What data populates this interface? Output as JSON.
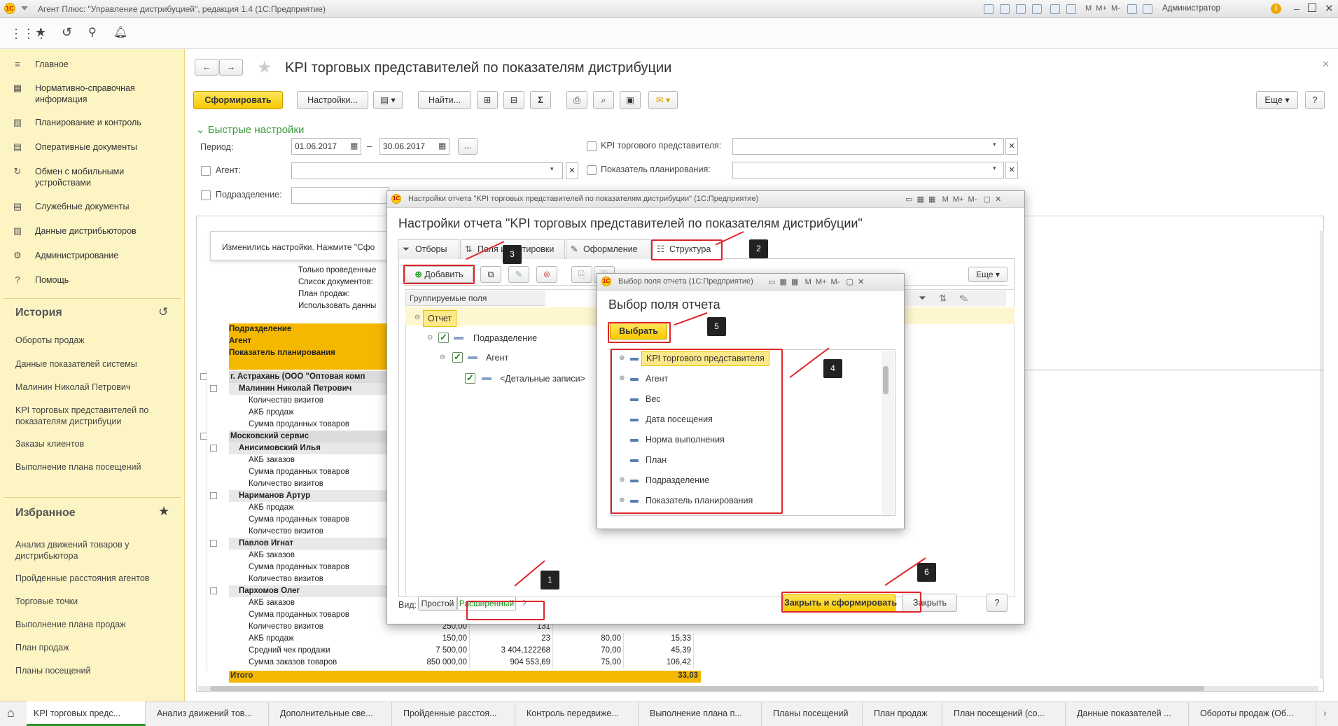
{
  "titlebar": {
    "title": "Агент Плюс: \"Управление дистрибуцией\", редакция 1.4  (1С:Предприятие)",
    "user": "Администратор"
  },
  "sidebar": {
    "items": [
      {
        "label": "Главное",
        "icon": "≡"
      },
      {
        "label": "Нормативно-справочная информация",
        "icon": "▦"
      },
      {
        "label": "Планирование и контроль",
        "icon": "▥"
      },
      {
        "label": "Оперативные документы",
        "icon": "▤"
      },
      {
        "label": "Обмен с мобильными устройствами",
        "icon": "↻"
      },
      {
        "label": "Служебные документы",
        "icon": "▤"
      },
      {
        "label": "Данные дистрибьюторов",
        "icon": "▥"
      },
      {
        "label": "Администрирование",
        "icon": "⚙"
      },
      {
        "label": "Помощь",
        "icon": "?"
      }
    ],
    "history_title": "История",
    "history": [
      "Обороты продаж",
      "Данные показателей системы",
      "Малинин Николай Петрович",
      "KPI торговых представителей по показателям дистрибуции",
      "Заказы клиентов",
      "Выполнение плана посещений"
    ],
    "favorites_title": "Избранное",
    "favorites": [
      "Анализ движений товаров у дистрибьютора",
      "Пройденные расстояния агентов",
      "Торговые точки",
      "Выполнение плана продаж",
      "План продаж",
      "Планы посещений"
    ]
  },
  "main": {
    "title": "KPI торговых представителей по показателям дистрибуции",
    "form_button": "Сформировать",
    "settings_button": "Настройки...",
    "find_button": "Найти...",
    "more_button": "Еще",
    "help_button": "?",
    "quick_settings": "Быстрые настройки",
    "period_label": "Период:",
    "date_from": "01.06.2017",
    "date_to": "30.06.2017",
    "dash": "–",
    "ellipsis": "...",
    "agent_label": "Агент:",
    "division_label": "Подразделение:",
    "kpi_label": "KPI торгового представителя:",
    "indicator_label": "Показатель планирования:"
  },
  "report": {
    "notice": "Изменились настройки. Нажмите \"Сфо",
    "filters": [
      "Только проведенные",
      "Список документов:",
      "План продаж:",
      "Использовать данны"
    ],
    "headers": [
      "Подразделение",
      "Агент",
      "Показатель планирования"
    ],
    "rows": [
      {
        "text": "г. Астрахань (ООО \"Оптовая комп",
        "bold": true,
        "bg": "#dcdcdc",
        "indent": 0
      },
      {
        "text": "Малинин Николай Петрович",
        "bold": true,
        "bg": "#e8e8e8",
        "indent": 1
      },
      {
        "text": "Количество визитов",
        "indent": 2
      },
      {
        "text": "АКБ продаж",
        "indent": 2
      },
      {
        "text": "Сумма проданных товаров",
        "indent": 2
      },
      {
        "text": "Московский сервис",
        "bold": true,
        "bg": "#dcdcdc",
        "indent": 0
      },
      {
        "text": "Анисимовский Илья",
        "bold": true,
        "bg": "#e8e8e8",
        "indent": 1
      },
      {
        "text": "АКБ заказов",
        "indent": 2
      },
      {
        "text": "Сумма проданных товаров",
        "indent": 2
      },
      {
        "text": "Количество визитов",
        "indent": 2
      },
      {
        "text": "Нариманов Артур",
        "bold": true,
        "bg": "#e8e8e8",
        "indent": 1
      },
      {
        "text": "АКБ продаж",
        "indent": 2
      },
      {
        "text": "Сумма проданных товаров",
        "indent": 2
      },
      {
        "text": "Количество визитов",
        "indent": 2
      },
      {
        "text": "Павлов Игнат",
        "bold": true,
        "bg": "#e8e8e8",
        "indent": 1
      },
      {
        "text": "АКБ заказов",
        "indent": 2
      },
      {
        "text": "Сумма проданных товаров",
        "indent": 2
      },
      {
        "text": "Количество визитов",
        "indent": 2
      },
      {
        "text": "Пархомов Олег",
        "bold": true,
        "bg": "#e8e8e8",
        "indent": 1
      },
      {
        "text": "АКБ заказов",
        "indent": 2
      },
      {
        "text": "Сумма проданных товаров",
        "indent": 2
      },
      {
        "text": "Количество визитов",
        "indent": 2,
        "vals": [
          "250,00",
          "131",
          "",
          ""
        ]
      },
      {
        "text": "АКБ продаж",
        "indent": 2,
        "vals": [
          "150,00",
          "23",
          "80,00",
          "15,33"
        ]
      },
      {
        "text": "Средний чек продажи",
        "indent": 2,
        "vals": [
          "7 500,00",
          "3 404,122268",
          "70,00",
          "45,39"
        ]
      },
      {
        "text": "Сумма заказов товаров",
        "indent": 2,
        "vals": [
          "850 000,00",
          "904 553,69",
          "75,00",
          "106,42"
        ]
      }
    ],
    "total_label": "Итого",
    "total_value": "33,03"
  },
  "settings_dialog": {
    "window_title": "Настройки отчета \"KPI торговых представителей по показателям дистрибуции\"  (1С:Предприятие)",
    "heading": "Настройки отчета \"KPI торговых представителей по показателям дистрибуции\"",
    "tabs": [
      "Отборы",
      "Поля и сортировки",
      "Оформление",
      "Структура"
    ],
    "add_button": "Добавить",
    "more_button": "Еще",
    "column_header": "Группируемые поля",
    "tree": [
      "Отчет",
      "Подразделение",
      "Агент",
      "<Детальные записи>"
    ],
    "view_label": "Вид:",
    "simple": "Простой",
    "extended": "Расширенный",
    "help": "?",
    "close_form": "Закрыть и сформировать",
    "close": "Закрыть"
  },
  "field_dialog": {
    "window_title": "Выбор поля отчета  (1С:Предприятие)",
    "heading": "Выбор поля отчета",
    "select_button": "Выбрать",
    "fields": [
      "KPI торгового представителя",
      "Агент",
      "Вес",
      "Дата посещения",
      "Норма выполнения",
      "План",
      "Подразделение",
      "Показатель планирования"
    ]
  },
  "callouts": [
    "1",
    "2",
    "3",
    "4",
    "5",
    "6"
  ],
  "footer_tabs": [
    "KPI торговых предс...",
    "Анализ движений тов...",
    "Дополнительные све...",
    "Пройденные расстоя...",
    "Контроль передвиже...",
    "Выполнение плана п...",
    "Планы посещений",
    "План продаж",
    "План посещений  (со...",
    "Данные показателей ...",
    "Обороты продаж (Об..."
  ],
  "colors": {
    "accent_yellow": "#f7c800",
    "sidebar_bg": "#fdf4c4",
    "callout_red": "#e0242a",
    "header_orange": "#f5b800"
  }
}
